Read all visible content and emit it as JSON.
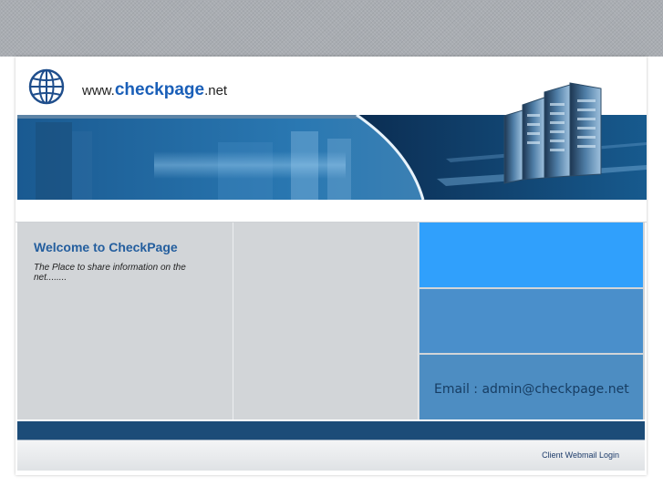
{
  "header": {
    "site_prefix": "www.",
    "site_domain": "checkpage",
    "site_suffix": ".net",
    "logo_icon": "globe-icon"
  },
  "welcome": {
    "title": "Welcome to CheckPage",
    "text": "The Place to share information on the net........"
  },
  "contact": {
    "email_text": "Email : admin@checkpage.net"
  },
  "footer": {
    "webmail_label": "Client Webmail Login"
  },
  "colors": {
    "top_band": "#a9adb2",
    "box_1": "#30a0fc",
    "box_2": "#4a8fcb",
    "box_3": "#4d8dc2",
    "dark_bar": "#1c4c78",
    "welcome_title": "#245e9e"
  }
}
